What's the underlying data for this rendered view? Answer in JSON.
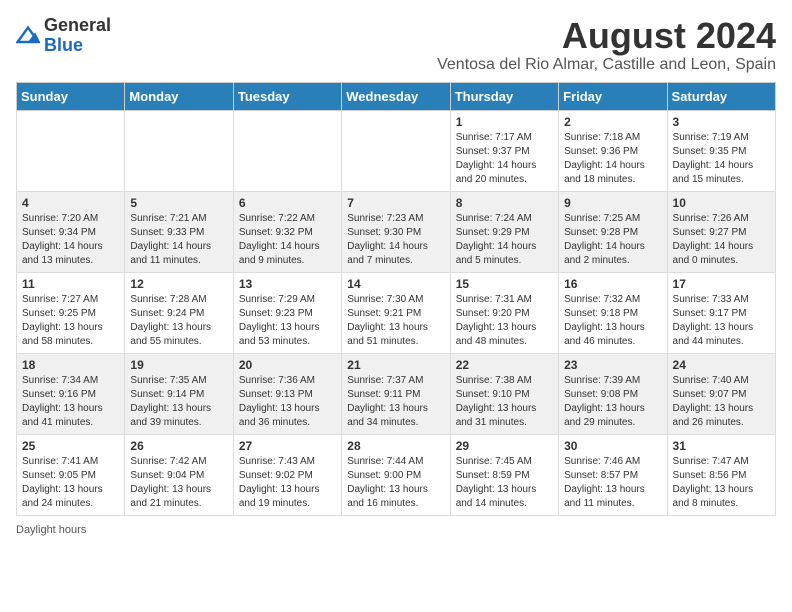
{
  "header": {
    "logo_general": "General",
    "logo_blue": "Blue",
    "title": "August 2024",
    "subtitle": "Ventosa del Rio Almar, Castille and Leon, Spain"
  },
  "calendar": {
    "days_of_week": [
      "Sunday",
      "Monday",
      "Tuesday",
      "Wednesday",
      "Thursday",
      "Friday",
      "Saturday"
    ],
    "weeks": [
      [
        {
          "day": "",
          "info": ""
        },
        {
          "day": "",
          "info": ""
        },
        {
          "day": "",
          "info": ""
        },
        {
          "day": "",
          "info": ""
        },
        {
          "day": "1",
          "info": "Sunrise: 7:17 AM\nSunset: 9:37 PM\nDaylight: 14 hours and 20 minutes."
        },
        {
          "day": "2",
          "info": "Sunrise: 7:18 AM\nSunset: 9:36 PM\nDaylight: 14 hours and 18 minutes."
        },
        {
          "day": "3",
          "info": "Sunrise: 7:19 AM\nSunset: 9:35 PM\nDaylight: 14 hours and 15 minutes."
        }
      ],
      [
        {
          "day": "4",
          "info": "Sunrise: 7:20 AM\nSunset: 9:34 PM\nDaylight: 14 hours and 13 minutes."
        },
        {
          "day": "5",
          "info": "Sunrise: 7:21 AM\nSunset: 9:33 PM\nDaylight: 14 hours and 11 minutes."
        },
        {
          "day": "6",
          "info": "Sunrise: 7:22 AM\nSunset: 9:32 PM\nDaylight: 14 hours and 9 minutes."
        },
        {
          "day": "7",
          "info": "Sunrise: 7:23 AM\nSunset: 9:30 PM\nDaylight: 14 hours and 7 minutes."
        },
        {
          "day": "8",
          "info": "Sunrise: 7:24 AM\nSunset: 9:29 PM\nDaylight: 14 hours and 5 minutes."
        },
        {
          "day": "9",
          "info": "Sunrise: 7:25 AM\nSunset: 9:28 PM\nDaylight: 14 hours and 2 minutes."
        },
        {
          "day": "10",
          "info": "Sunrise: 7:26 AM\nSunset: 9:27 PM\nDaylight: 14 hours and 0 minutes."
        }
      ],
      [
        {
          "day": "11",
          "info": "Sunrise: 7:27 AM\nSunset: 9:25 PM\nDaylight: 13 hours and 58 minutes."
        },
        {
          "day": "12",
          "info": "Sunrise: 7:28 AM\nSunset: 9:24 PM\nDaylight: 13 hours and 55 minutes."
        },
        {
          "day": "13",
          "info": "Sunrise: 7:29 AM\nSunset: 9:23 PM\nDaylight: 13 hours and 53 minutes."
        },
        {
          "day": "14",
          "info": "Sunrise: 7:30 AM\nSunset: 9:21 PM\nDaylight: 13 hours and 51 minutes."
        },
        {
          "day": "15",
          "info": "Sunrise: 7:31 AM\nSunset: 9:20 PM\nDaylight: 13 hours and 48 minutes."
        },
        {
          "day": "16",
          "info": "Sunrise: 7:32 AM\nSunset: 9:18 PM\nDaylight: 13 hours and 46 minutes."
        },
        {
          "day": "17",
          "info": "Sunrise: 7:33 AM\nSunset: 9:17 PM\nDaylight: 13 hours and 44 minutes."
        }
      ],
      [
        {
          "day": "18",
          "info": "Sunrise: 7:34 AM\nSunset: 9:16 PM\nDaylight: 13 hours and 41 minutes."
        },
        {
          "day": "19",
          "info": "Sunrise: 7:35 AM\nSunset: 9:14 PM\nDaylight: 13 hours and 39 minutes."
        },
        {
          "day": "20",
          "info": "Sunrise: 7:36 AM\nSunset: 9:13 PM\nDaylight: 13 hours and 36 minutes."
        },
        {
          "day": "21",
          "info": "Sunrise: 7:37 AM\nSunset: 9:11 PM\nDaylight: 13 hours and 34 minutes."
        },
        {
          "day": "22",
          "info": "Sunrise: 7:38 AM\nSunset: 9:10 PM\nDaylight: 13 hours and 31 minutes."
        },
        {
          "day": "23",
          "info": "Sunrise: 7:39 AM\nSunset: 9:08 PM\nDaylight: 13 hours and 29 minutes."
        },
        {
          "day": "24",
          "info": "Sunrise: 7:40 AM\nSunset: 9:07 PM\nDaylight: 13 hours and 26 minutes."
        }
      ],
      [
        {
          "day": "25",
          "info": "Sunrise: 7:41 AM\nSunset: 9:05 PM\nDaylight: 13 hours and 24 minutes."
        },
        {
          "day": "26",
          "info": "Sunrise: 7:42 AM\nSunset: 9:04 PM\nDaylight: 13 hours and 21 minutes."
        },
        {
          "day": "27",
          "info": "Sunrise: 7:43 AM\nSunset: 9:02 PM\nDaylight: 13 hours and 19 minutes."
        },
        {
          "day": "28",
          "info": "Sunrise: 7:44 AM\nSunset: 9:00 PM\nDaylight: 13 hours and 16 minutes."
        },
        {
          "day": "29",
          "info": "Sunrise: 7:45 AM\nSunset: 8:59 PM\nDaylight: 13 hours and 14 minutes."
        },
        {
          "day": "30",
          "info": "Sunrise: 7:46 AM\nSunset: 8:57 PM\nDaylight: 13 hours and 11 minutes."
        },
        {
          "day": "31",
          "info": "Sunrise: 7:47 AM\nSunset: 8:56 PM\nDaylight: 13 hours and 8 minutes."
        }
      ]
    ]
  },
  "footer": {
    "note": "Daylight hours"
  }
}
